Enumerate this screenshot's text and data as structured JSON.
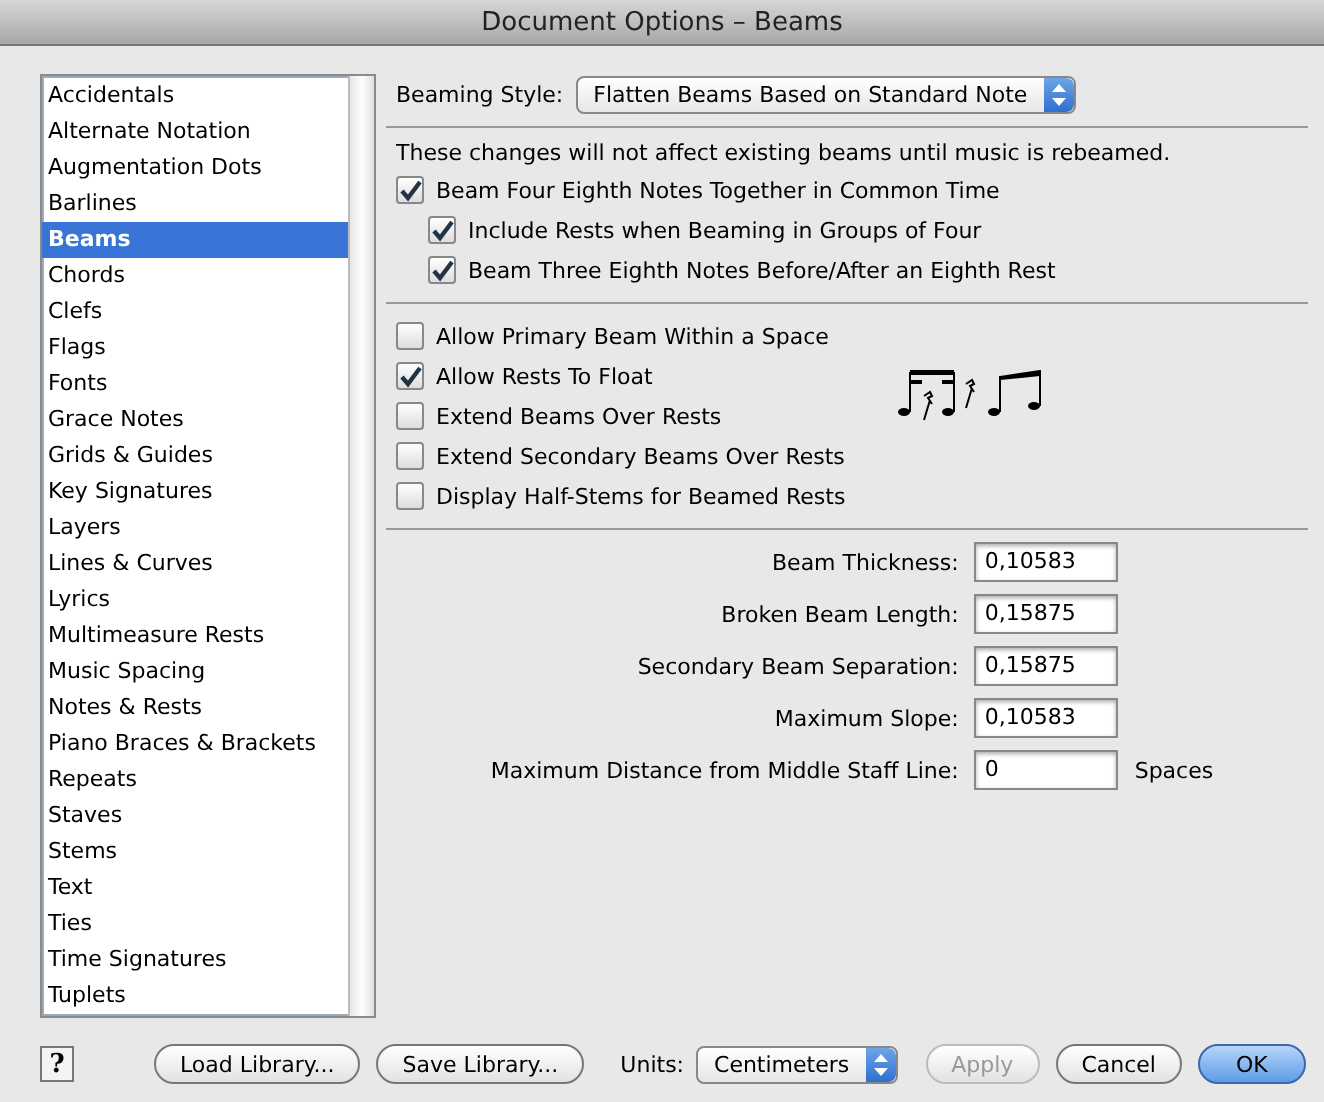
{
  "window": {
    "title": "Document Options – Beams"
  },
  "sidebar": {
    "items": [
      {
        "label": "Accidentals",
        "selected": false
      },
      {
        "label": "Alternate Notation",
        "selected": false
      },
      {
        "label": "Augmentation Dots",
        "selected": false
      },
      {
        "label": "Barlines",
        "selected": false
      },
      {
        "label": "Beams",
        "selected": true
      },
      {
        "label": "Chords",
        "selected": false
      },
      {
        "label": "Clefs",
        "selected": false
      },
      {
        "label": "Flags",
        "selected": false
      },
      {
        "label": "Fonts",
        "selected": false
      },
      {
        "label": "Grace Notes",
        "selected": false
      },
      {
        "label": "Grids & Guides",
        "selected": false
      },
      {
        "label": "Key Signatures",
        "selected": false
      },
      {
        "label": "Layers",
        "selected": false
      },
      {
        "label": "Lines & Curves",
        "selected": false
      },
      {
        "label": "Lyrics",
        "selected": false
      },
      {
        "label": "Multimeasure Rests",
        "selected": false
      },
      {
        "label": "Music Spacing",
        "selected": false
      },
      {
        "label": "Notes & Rests",
        "selected": false
      },
      {
        "label": "Piano Braces & Brackets",
        "selected": false
      },
      {
        "label": "Repeats",
        "selected": false
      },
      {
        "label": "Staves",
        "selected": false
      },
      {
        "label": "Stems",
        "selected": false
      },
      {
        "label": "Text",
        "selected": false
      },
      {
        "label": "Ties",
        "selected": false
      },
      {
        "label": "Time Signatures",
        "selected": false
      },
      {
        "label": "Tuplets",
        "selected": false
      }
    ]
  },
  "beaming_style": {
    "label": "Beaming Style:",
    "value": "Flatten Beams Based on Standard Note"
  },
  "note": "These changes will not affect existing beams until music is rebeamed.",
  "group_1": [
    {
      "label": "Beam Four Eighth Notes Together in Common Time",
      "checked": true,
      "children": [
        {
          "label": "Include Rests when Beaming in Groups of Four",
          "checked": true
        },
        {
          "label": "Beam Three Eighth Notes Before/After an Eighth Rest",
          "checked": true
        }
      ]
    }
  ],
  "group_2": [
    {
      "label": "Allow Primary Beam Within a Space",
      "checked": false
    },
    {
      "label": "Allow Rests To Float",
      "checked": true
    },
    {
      "label": "Extend Beams Over Rests",
      "checked": false
    },
    {
      "label": "Extend Secondary Beams Over Rests",
      "checked": false
    },
    {
      "label": "Display Half-Stems for Beamed Rests",
      "checked": false
    }
  ],
  "fields": [
    {
      "label": "Beam Thickness:",
      "value": "0,10583"
    },
    {
      "label": "Broken Beam Length:",
      "value": "0,15875"
    },
    {
      "label": "Secondary Beam Separation:",
      "value": "0,15875"
    },
    {
      "label": "Maximum Slope:",
      "value": "0,10583"
    },
    {
      "label": "Maximum Distance from Middle Staff Line:",
      "value": "0",
      "unit": "Spaces"
    }
  ],
  "footer": {
    "help": "?",
    "left_buttons": [
      {
        "label": "Load Library..."
      },
      {
        "label": "Save Library..."
      }
    ],
    "units": {
      "label": "Units:",
      "value": "Centimeters"
    },
    "right_buttons": [
      {
        "label": "Apply",
        "disabled": true,
        "kind": "normal"
      },
      {
        "label": "Cancel",
        "disabled": false,
        "kind": "normal"
      },
      {
        "label": "OK",
        "disabled": false,
        "kind": "default"
      }
    ]
  }
}
